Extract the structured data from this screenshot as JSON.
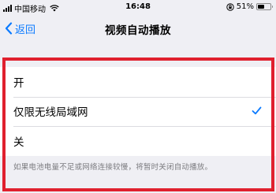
{
  "status_bar": {
    "carrier": "中国移动",
    "time": "16:48",
    "battery_percent": "51%",
    "battery_level": 0.51
  },
  "nav": {
    "back_label": "返回",
    "title": "视频自动播放"
  },
  "options": [
    {
      "label": "开",
      "selected": false
    },
    {
      "label": "仅限无线局域网",
      "selected": true
    },
    {
      "label": "关",
      "selected": false
    }
  ],
  "footer_note": "如果电池电量不足或网络连接较慢，将暂时关闭自动播放。",
  "colors": {
    "accent": "#0a7aff",
    "highlight": "#e0202e",
    "background": "#efeff4"
  }
}
